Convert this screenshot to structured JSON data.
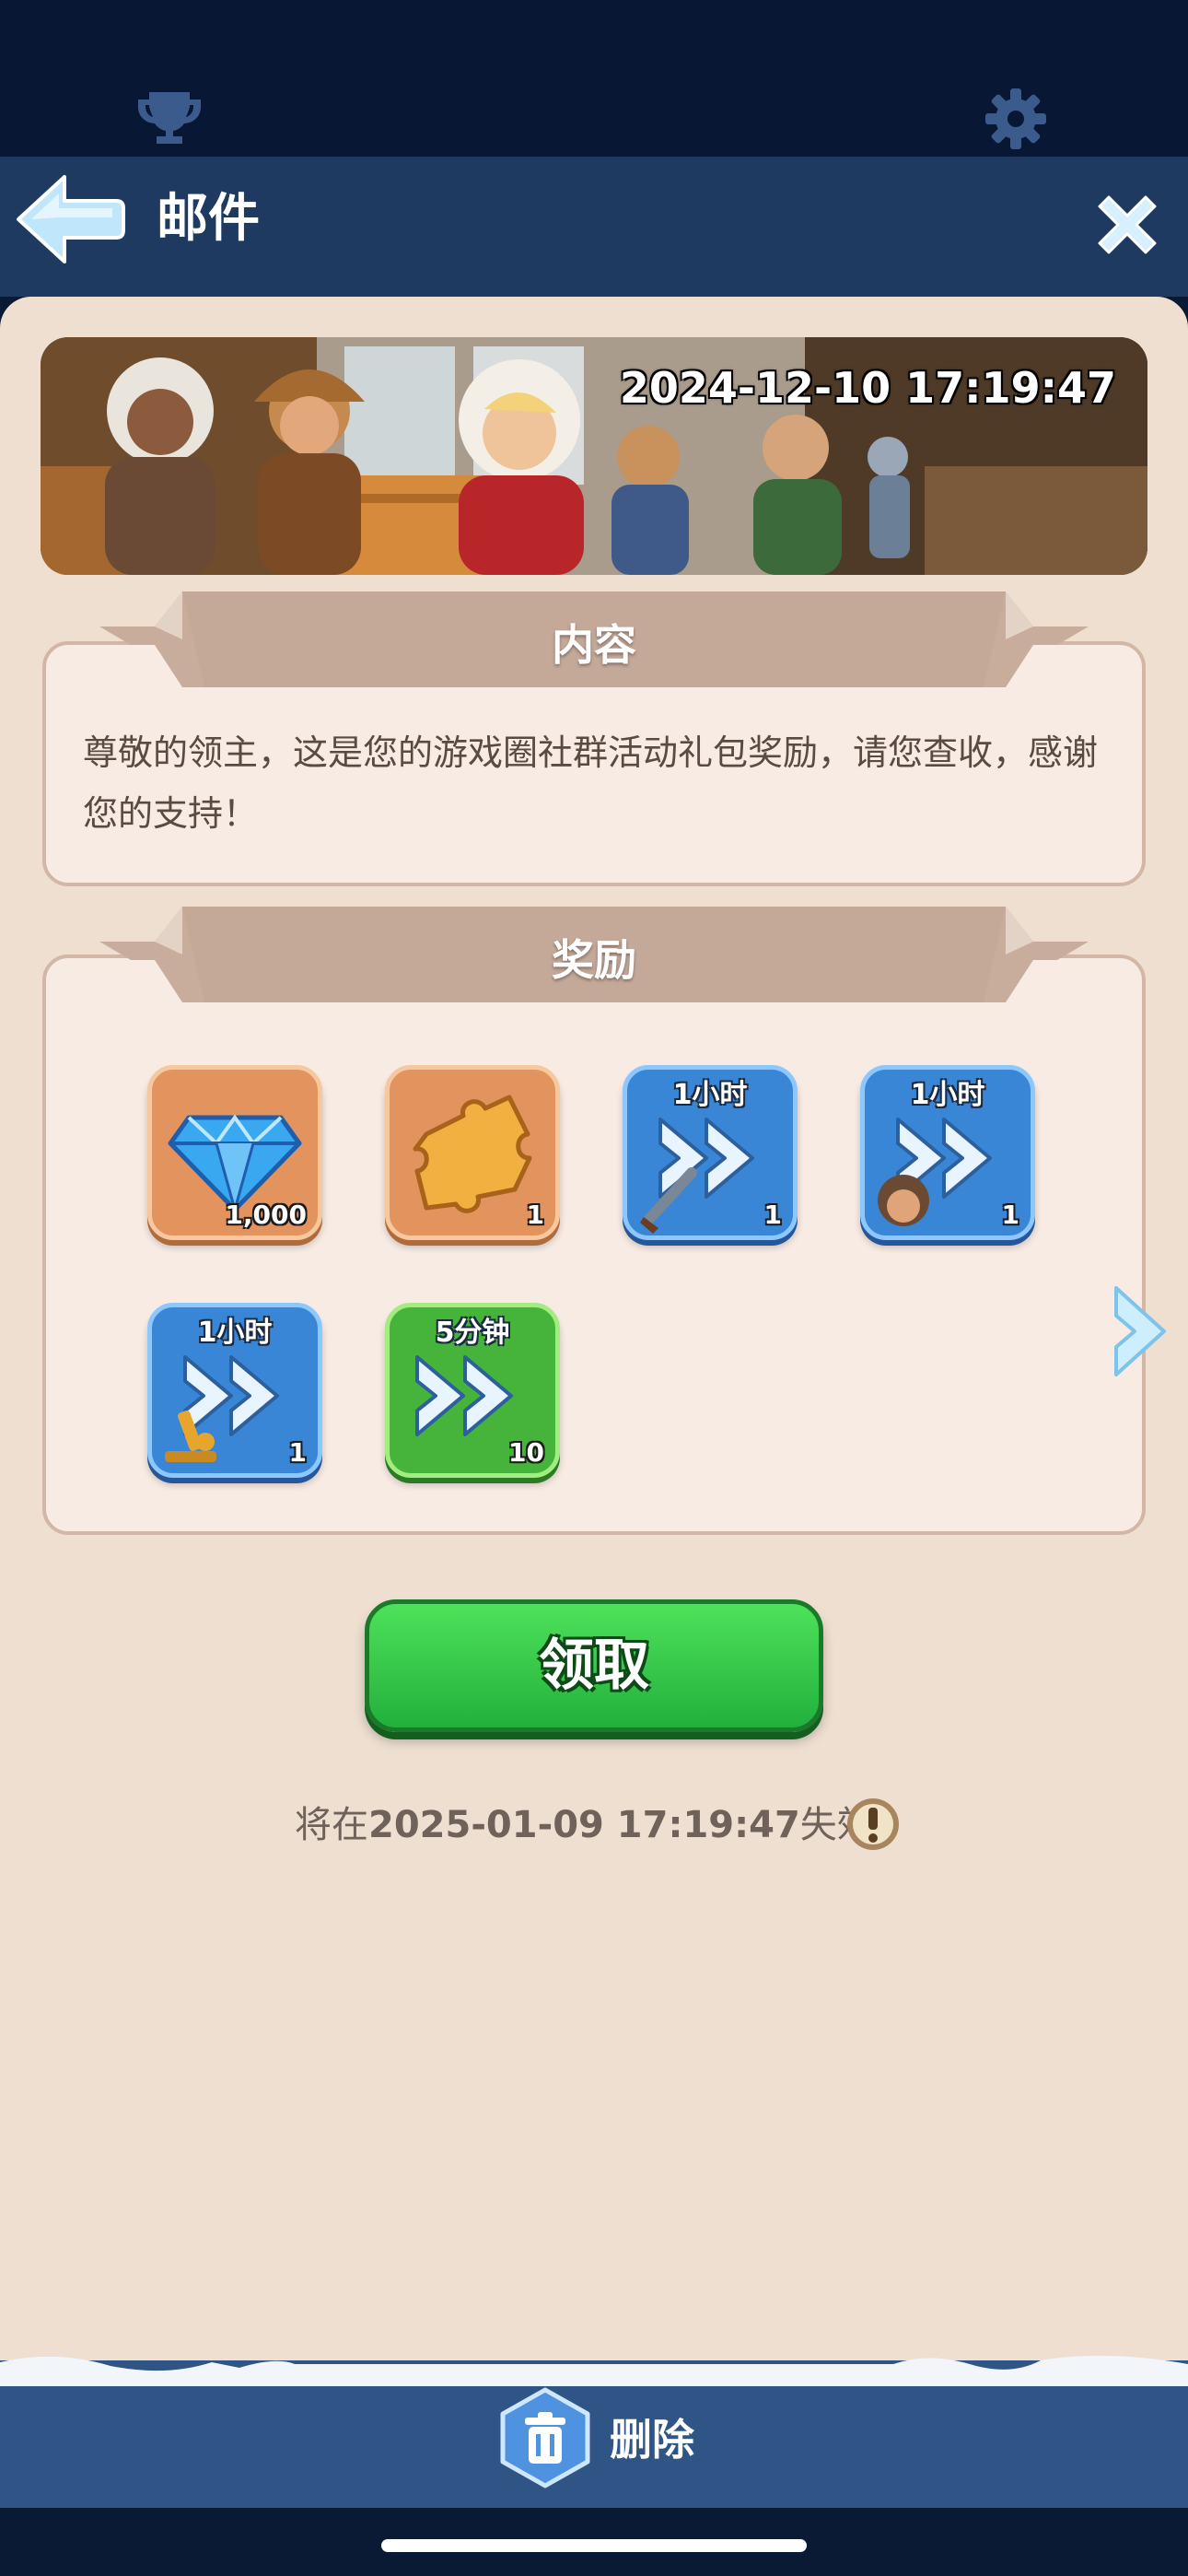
{
  "header": {
    "title": "邮件"
  },
  "banner": {
    "timestamp": "2024-12-10 17:19:47"
  },
  "content_section": {
    "title": "内容",
    "message": "尊敬的领主，这是您的游戏圈社群活动礼包奖励，请您查收，感谢您的支持！"
  },
  "rewards_section": {
    "title": "奖励",
    "items": [
      {
        "icon": "diamond-icon",
        "style": "orange",
        "label": "",
        "quantity": "1,000"
      },
      {
        "icon": "puzzle-piece-icon",
        "style": "orange",
        "label": "",
        "quantity": "1"
      },
      {
        "icon": "speedup-sword-icon",
        "style": "blue",
        "label": "1小时",
        "quantity": "1"
      },
      {
        "icon": "speedup-soldier-icon",
        "style": "blue",
        "label": "1小时",
        "quantity": "1"
      },
      {
        "icon": "speedup-research-icon",
        "style": "blue",
        "label": "1小时",
        "quantity": "1"
      },
      {
        "icon": "speedup-general-icon",
        "style": "green",
        "label": "5分钟",
        "quantity": "10"
      }
    ]
  },
  "claim_button": {
    "label": "领取"
  },
  "expiry": {
    "prefix": "将在",
    "datetime": "2025-01-09 17:19:47",
    "suffix": "失效"
  },
  "bottom_bar": {
    "delete_label": "删除"
  },
  "colors": {
    "panel_background": "#eedfd1",
    "header_background": "#1e3a60",
    "claim_button_green": "#2fc444",
    "bottom_bar": "#2f5586"
  }
}
